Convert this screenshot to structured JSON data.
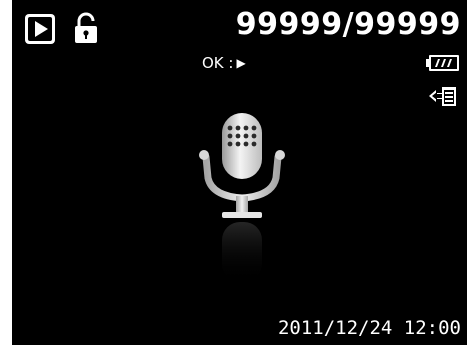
{
  "status_bar": {
    "play_mode_icon": "playback-mode-icon",
    "protect_icon": "lock-icon",
    "file_counter": "99999/99999",
    "battery_icon": "battery-full-icon",
    "transfer_icon": "dpof-transfer-icon"
  },
  "hint": {
    "ok_label": "OK :",
    "ok_action_icon": "play-triangle-icon"
  },
  "content": {
    "media_type_icon": "microphone-icon"
  },
  "footer": {
    "datetime": "2011/12/24 12:00"
  },
  "colors": {
    "background": "#000000",
    "foreground": "#ffffff",
    "frame": "#ffffff"
  }
}
